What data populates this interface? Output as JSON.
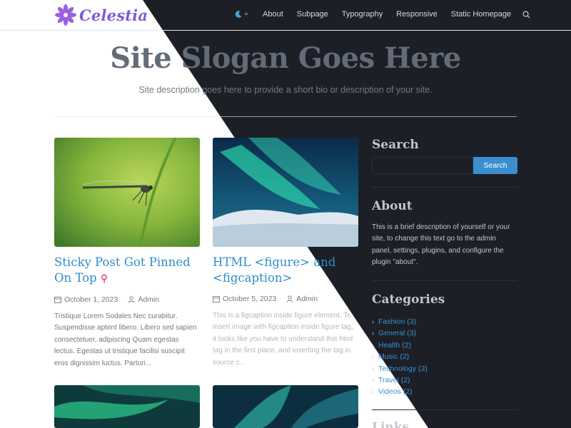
{
  "brand": {
    "name": "Celestia"
  },
  "nav": {
    "items": [
      "About",
      "Subpage",
      "Typography",
      "Responsive",
      "Static Homepage"
    ]
  },
  "hero": {
    "title": "Site Slogan Goes Here",
    "description": "Site description goes here to provide a short bio or description of your site."
  },
  "posts": [
    {
      "title": "Sticky Post Got Pinned On Top",
      "date": "October 1, 2023",
      "author": "Admin",
      "excerpt": "Tristique Lorem Sodales Nec curabitur. Suspendisse aptent libero. Libero sed sapien consectetuer, adipiscing Quam egestas lectus. Egestas ut tristique facilisi suscipit eros dignissim luctus. Parturi..."
    },
    {
      "title": "HTML <figure> and <figcaption>",
      "date": "October 5, 2023",
      "author": "Admin",
      "excerpt": "This is a figcaption inside figure element. To insert image with figcaption inside figure tag, it looks like you have to understand this html tag in the first place, and inserting the tag in source c..."
    }
  ],
  "sidebar": {
    "search": {
      "title": "Search",
      "button": "Search"
    },
    "about": {
      "title": "About",
      "text": "This is a brief description of yourself or your site, to change this text go to the admin panel, settings, plugins, and configure the plugin \"about\"."
    },
    "categories": {
      "title": "Categories",
      "items": [
        "Fashion (3)",
        "General (3)",
        "Health (2)",
        "Music (2)",
        "Technology (3)",
        "Travel (2)",
        "Videos (2)"
      ]
    },
    "links": {
      "title": "Links"
    }
  },
  "colors": {
    "accent": "#3a8fcf",
    "dark_bg": "#1c1f26",
    "light_bg": "#ffffff",
    "pin": "#e0245e"
  }
}
